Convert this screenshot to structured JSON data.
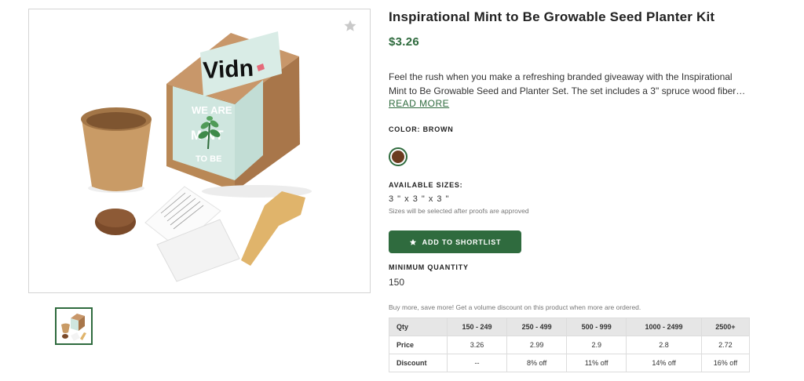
{
  "product": {
    "title": "Inspirational Mint to Be Growable Seed Planter Kit",
    "price": "$3.26",
    "description": "Feel the rush when you make a refreshing branded giveaway with the Inspirational Mint to Be Growable Seed and Planter Set. The set includes a 3\" spruce wood fiber…",
    "read_more": "READ MORE"
  },
  "image": {
    "box_logo": "Vidn",
    "box_text_line1": "WE ARE",
    "box_text_line2": "M  NT",
    "box_text_line3": "TO BE",
    "card_title": "Growables Planter",
    "favorite_icon": "star-icon"
  },
  "color": {
    "label": "COLOR: BROWN",
    "swatch": "#6b3b1f",
    "accent": "#2f6b3e"
  },
  "sizes": {
    "label": "AVAILABLE SIZES:",
    "value": "3 \" x 3 \" x 3 \"",
    "note": "Sizes will be selected after proofs are approved"
  },
  "shortlist": {
    "label": "ADD TO SHORTLIST",
    "color": "#2f6b3e",
    "icon": "star-icon"
  },
  "minimum": {
    "label": "MINIMUM QUANTITY",
    "value": "150"
  },
  "volume_note": "Buy more, save more! Get a volume discount on this product when more are ordered.",
  "pricing_table": {
    "header": [
      "Qty",
      "150 - 249",
      "250 - 499",
      "500 - 999",
      "1000 - 2499",
      "2500+"
    ],
    "rows": [
      [
        "Price",
        "3.26",
        "2.99",
        "2.9",
        "2.8",
        "2.72"
      ],
      [
        "Discount",
        "--",
        "8% off",
        "11% off",
        "14% off",
        "16% off"
      ]
    ]
  }
}
